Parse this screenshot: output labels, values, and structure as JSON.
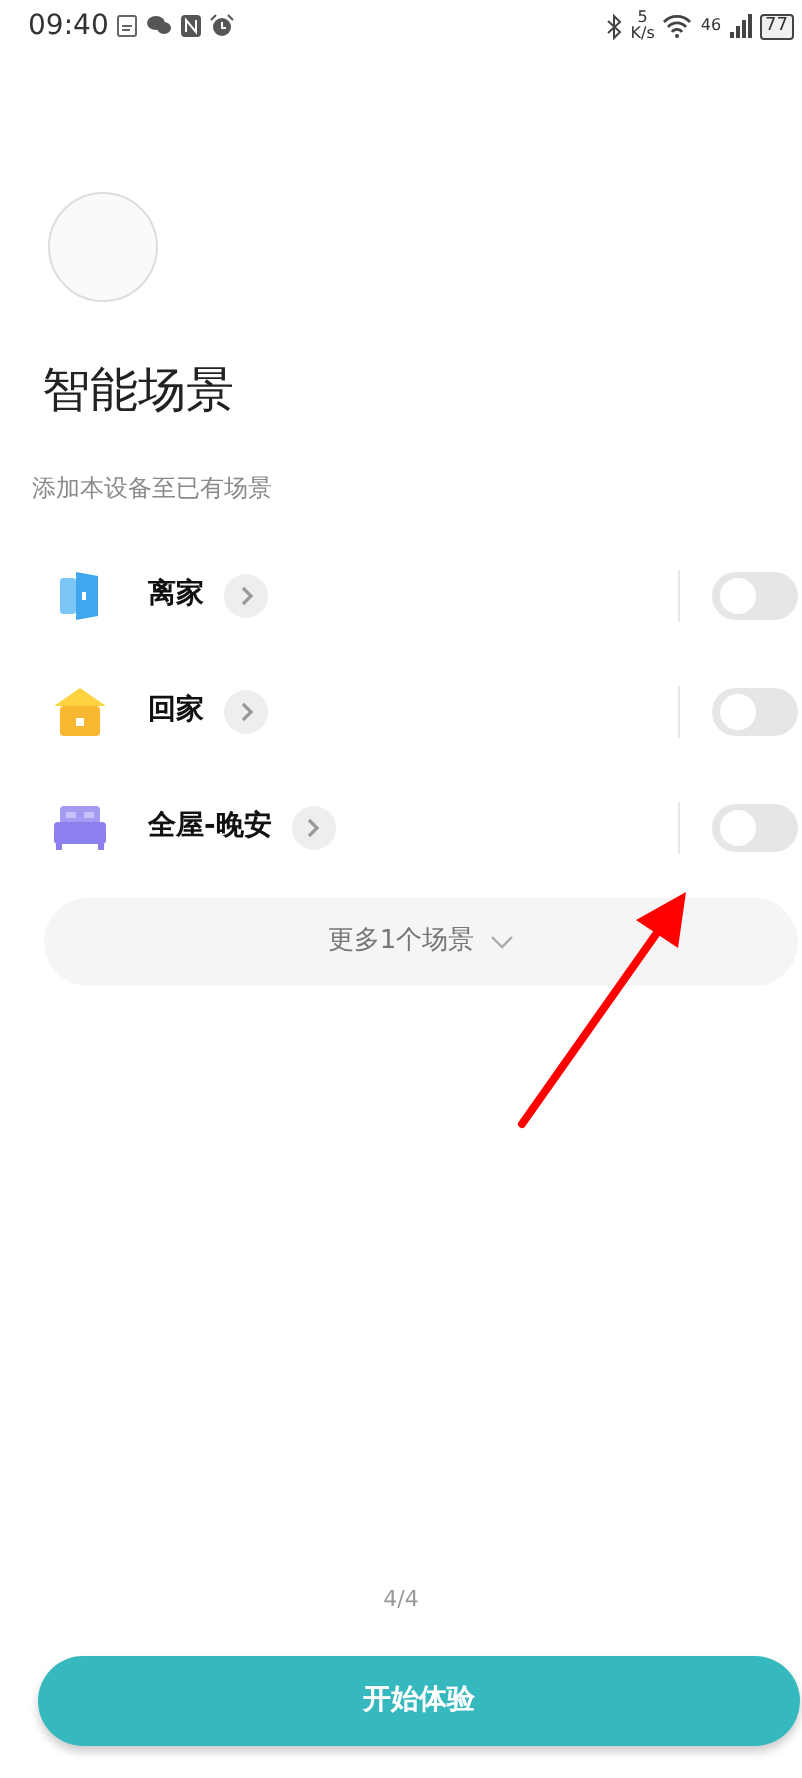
{
  "status_bar": {
    "time": "09:40",
    "speed_value": "5",
    "speed_unit": "K/s",
    "network": "46",
    "battery": "77"
  },
  "title": "智能场景",
  "subtitle": "添加本设备至已有场景",
  "scenes": [
    {
      "kind": "door",
      "name": "离家",
      "on": false
    },
    {
      "kind": "home",
      "name": "回家",
      "on": false
    },
    {
      "kind": "bed",
      "name": "全屋-晚安",
      "on": false
    }
  ],
  "more_button": "更多1个场景",
  "page_indicator": "4/4",
  "start_button": "开始体验",
  "annotation_arrow": {
    "color": "#ff0000"
  }
}
